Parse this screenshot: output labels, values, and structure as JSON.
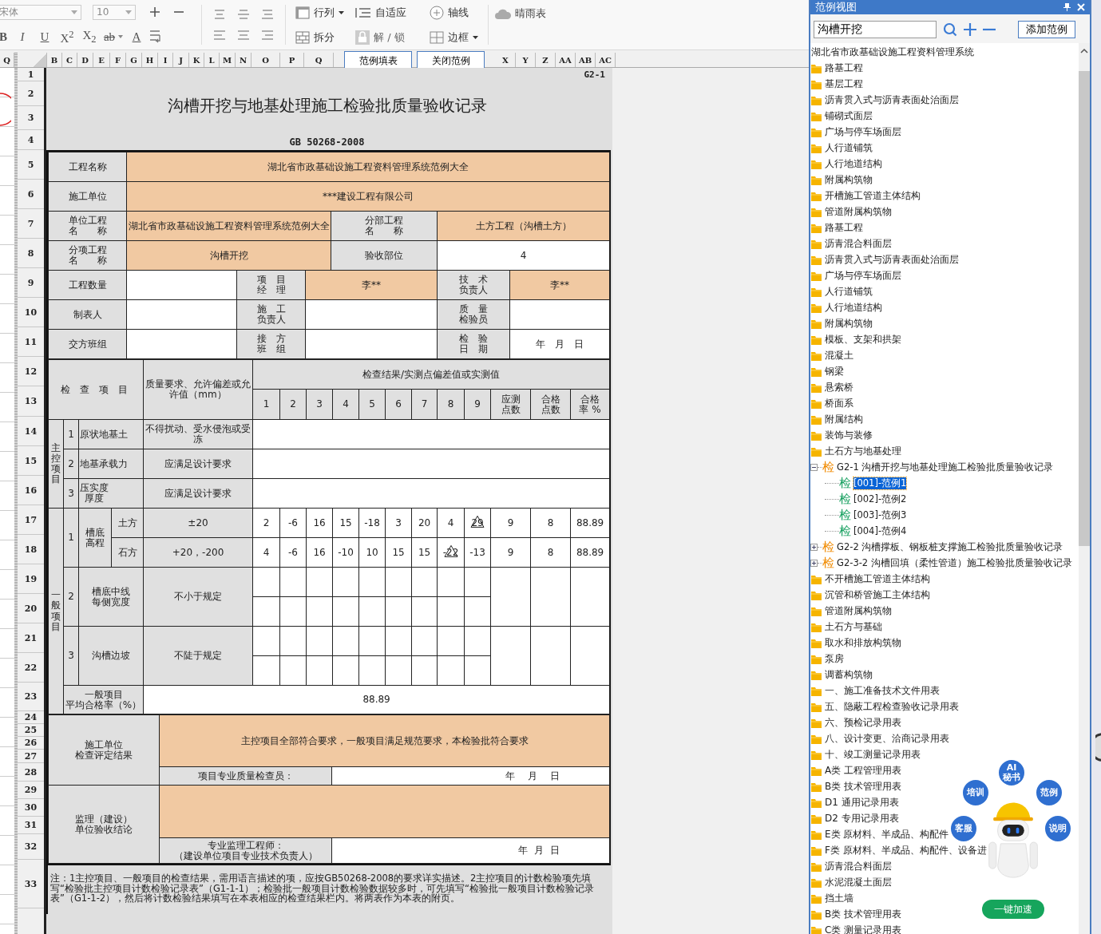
{
  "toolbar": {
    "font": "宋体",
    "size": "10",
    "format_buttons": [
      "B",
      "I",
      "U",
      "X$^{2}$",
      "X$_{2}$",
      "ab",
      "A"
    ],
    "tools": [
      {
        "label": "行列",
        "dropdown": true,
        "disabled": false
      },
      {
        "label": "自适应",
        "dropdown": false,
        "disabled": false
      },
      {
        "label": "轴线",
        "dropdown": false,
        "disabled": false
      },
      {
        "label": "拆分",
        "dropdown": false,
        "disabled": false
      },
      {
        "label": "解 / 锁",
        "dropdown": false,
        "disabled": true
      },
      {
        "label": "边框",
        "dropdown": true,
        "disabled": false
      }
    ],
    "weather": "晴雨表"
  },
  "sheet": {
    "sliver_column": "Q",
    "columns_left": [
      "B",
      "C",
      "D",
      "E",
      "F",
      "G",
      "H",
      "I",
      "J",
      "K",
      "L",
      "M",
      "N",
      "O",
      "P",
      "Q"
    ],
    "sheet_buttons": [
      "范例填表",
      "关闭范例"
    ],
    "columns_right": [
      "X",
      "Y",
      "Z",
      "AA",
      "AB",
      "AC"
    ],
    "rows": [
      "1",
      "2",
      "3",
      "4",
      "5",
      "6",
      "7",
      "8",
      "9",
      "10",
      "11",
      "12",
      "13",
      "14",
      "15",
      "16",
      "17",
      "18",
      "19",
      "20",
      "21",
      "22",
      "23",
      "24",
      "25",
      "26",
      "27",
      "28",
      "29",
      "30",
      "31",
      "32",
      "33"
    ]
  },
  "form": {
    "code": "G2-1",
    "title": "沟槽开挖与地基处理施工检验批质量验收记录",
    "standard": "GB 50268-2008",
    "info_rows": [
      {
        "cells": [
          {
            "text": "工程名称",
            "kind": "label"
          },
          {
            "text": "湖北省市政基础设施工程资料管理系统范例大全",
            "kind": "filled"
          }
        ]
      },
      {
        "cells": [
          {
            "text": "施工单位",
            "kind": "label"
          },
          {
            "text": "***建设工程有限公司",
            "kind": "filled"
          }
        ]
      },
      {
        "cells": [
          {
            "text": "单位工程名称",
            "kind": "label"
          },
          {
            "text": "湖北省市政基础设施工程资料管理系统范例大全",
            "kind": "filled"
          },
          {
            "text": "分部工程名称",
            "kind": "label"
          },
          {
            "text": "土方工程（沟槽土方）",
            "kind": "filled"
          }
        ]
      },
      {
        "cells": [
          {
            "text": "分项工程名称",
            "kind": "label"
          },
          {
            "text": "沟槽开挖",
            "kind": "filled"
          },
          {
            "text": "验收部位",
            "kind": "label"
          },
          {
            "text": "4",
            "kind": "plain"
          }
        ]
      },
      {
        "cells": [
          {
            "text": "工程数量",
            "kind": "label"
          },
          {
            "kind": "plain"
          },
          {
            "text": "项目经理",
            "kind": "label"
          },
          {
            "text": "李**",
            "kind": "filled"
          },
          {
            "text": "技术负责人",
            "kind": "label"
          },
          {
            "text": "李**",
            "kind": "filled"
          }
        ]
      },
      {
        "cells": [
          {
            "text": "制表人",
            "kind": "label"
          },
          {
            "kind": "plain"
          },
          {
            "text": "施工负责人",
            "kind": "label"
          },
          {
            "kind": "plain"
          },
          {
            "text": "质量检验员",
            "kind": "label"
          },
          {
            "kind": "plain"
          }
        ]
      },
      {
        "cells": [
          {
            "text": "交方班组",
            "kind": "label"
          },
          {
            "kind": "plain"
          },
          {
            "text": "接方班组",
            "kind": "label"
          },
          {
            "kind": "plain"
          },
          {
            "text": "检验日期",
            "kind": "label"
          },
          {
            "text": "年　月　日",
            "kind": "plain"
          }
        ]
      }
    ],
    "inspection": {
      "header_item": "检 查 项 目",
      "header_requirement": "质量要求、允许偏差或允许值（mm）",
      "header_results": "检查结果/实测点偏差值或实测值",
      "point_labels": [
        "1",
        "2",
        "3",
        "4",
        "5",
        "6",
        "7",
        "8",
        "9"
      ],
      "summary_labels": [
        "应测点数",
        "合格点数",
        "合格率 %"
      ],
      "main_group": {
        "label": "主控项目",
        "items": [
          {
            "no": "1",
            "name": "原状地基土",
            "requirement": "不得扰动、受水侵泡或受冻"
          },
          {
            "no": "2",
            "name": "地基承载力",
            "requirement": "应满足设计要求"
          },
          {
            "no": "3",
            "name": "压实度厚度",
            "requirement": "应满足设计要求"
          }
        ]
      },
      "general_group": {
        "label": "一般项目",
        "measured": {
          "no": "1",
          "name": "槽底高程",
          "subitems": [
            {
              "name": "土方",
              "requirement": "±20",
              "points": [
                {
                  "value": "2",
                  "flagged": false
                },
                {
                  "value": "-6",
                  "flagged": false
                },
                {
                  "value": "16",
                  "flagged": false
                },
                {
                  "value": "15",
                  "flagged": false
                },
                {
                  "value": "-18",
                  "flagged": false
                },
                {
                  "value": "3",
                  "flagged": false
                },
                {
                  "value": "20",
                  "flagged": false
                },
                {
                  "value": "4",
                  "flagged": false
                },
                {
                  "value": "29",
                  "flagged": true
                }
              ],
              "required": "9",
              "passed": "8",
              "rate": "88.89"
            },
            {
              "name": "石方",
              "requirement": "+20，-200",
              "points": [
                {
                  "value": "4",
                  "flagged": false
                },
                {
                  "value": "-6",
                  "flagged": false
                },
                {
                  "value": "16",
                  "flagged": false
                },
                {
                  "value": "-10",
                  "flagged": false
                },
                {
                  "value": "10",
                  "flagged": false
                },
                {
                  "value": "15",
                  "flagged": false
                },
                {
                  "value": "15",
                  "flagged": false
                },
                {
                  "value": "-22",
                  "flagged": true
                },
                {
                  "value": "-13",
                  "flagged": false
                }
              ],
              "required": "9",
              "passed": "8",
              "rate": "88.89"
            }
          ]
        },
        "items": [
          {
            "no": "2",
            "name": "槽底中线每侧宽度",
            "requirement": "不小于规定"
          },
          {
            "no": "3",
            "name": "沟槽边坡",
            "requirement": "不陡于规定"
          }
        ],
        "average_label": "一般项目平均合格率（%）",
        "average": "88.89"
      }
    },
    "contractor": {
      "label": "施工单位检查评定结果",
      "conclusion": "主控项目全部符合要求，一般项目满足规范要求，本检验批符合要求",
      "signer": "项目专业质量检查员：",
      "date": "年　月　日"
    },
    "supervisor": {
      "label": "监理（建设）单位验收结论",
      "signer": "专业监理工程师：（建设单位项目专业技术负责人）",
      "date": "年 月 日"
    },
    "note": "注：1主控项目、一般项目的检查结果，需用语言描述的项，应按GB50268-2008的要求详实描述。2主控项目的计数检验项先填写“检验批主控项目计数检验记录表”（G1-1-1）；检验批一般项目计数检验数据较多时，可先填写“检验批一般项目计数检验记录表”（G1-1-2），然后将计数检验结果填写在本表相应的检查结果栏内。将两表作为本表的附页。"
  },
  "panel": {
    "title": "范例视图",
    "search": "沟槽开挖",
    "add_button": "添加范例",
    "tree": {
      "label": "湖北省市政基础设施工程资料管理系统",
      "children": [
        {
          "label": "路基工程",
          "kind": "folder"
        },
        {
          "label": "基层工程",
          "kind": "folder"
        },
        {
          "label": "沥青贯入式与沥青表面处治面层",
          "kind": "folder"
        },
        {
          "label": "铺砌式面层",
          "kind": "folder"
        },
        {
          "label": "广场与停车场面层",
          "kind": "folder"
        },
        {
          "label": "人行道铺筑",
          "kind": "folder"
        },
        {
          "label": "人行地道结构",
          "kind": "folder"
        },
        {
          "label": "附属构筑物",
          "kind": "folder"
        },
        {
          "label": "开槽施工管道主体结构",
          "kind": "folder"
        },
        {
          "label": "管道附属构筑物",
          "kind": "folder"
        },
        {
          "label": "路基工程",
          "kind": "folder"
        },
        {
          "label": "沥青混合料面层",
          "kind": "folder"
        },
        {
          "label": "沥青贯入式与沥青表面处治面层",
          "kind": "folder"
        },
        {
          "label": "广场与停车场面层",
          "kind": "folder"
        },
        {
          "label": "人行道铺筑",
          "kind": "folder"
        },
        {
          "label": "人行地道结构",
          "kind": "folder"
        },
        {
          "label": "附属构筑物",
          "kind": "folder"
        },
        {
          "label": "模板、支架和拱架",
          "kind": "folder"
        },
        {
          "label": "混凝土",
          "kind": "folder"
        },
        {
          "label": "钢梁",
          "kind": "folder"
        },
        {
          "label": "悬索桥",
          "kind": "folder"
        },
        {
          "label": "桥面系",
          "kind": "folder"
        },
        {
          "label": "附属结构",
          "kind": "folder"
        },
        {
          "label": "装饰与装修",
          "kind": "folder"
        },
        {
          "label": "土石方与地基处理",
          "kind": "folder"
        },
        {
          "label": "G2-1  沟槽开挖与地基处理施工检验批质量验收记录",
          "kind": "form",
          "badge": "检",
          "expanded": true,
          "children": [
            {
              "label": "[001]-范例1",
              "kind": "example",
              "badge": "检",
              "selected": true
            },
            {
              "label": "[002]-范例2",
              "kind": "example",
              "badge": "检",
              "selected": false
            },
            {
              "label": "[003]-范例3",
              "kind": "example",
              "badge": "检",
              "selected": false
            },
            {
              "label": "[004]-范例4",
              "kind": "example",
              "badge": "检",
              "selected": false
            }
          ]
        },
        {
          "label": "G2-2  沟槽撑板、钢板桩支撑施工检验批质量验收记录",
          "kind": "form",
          "badge": "检",
          "expanded": false
        },
        {
          "label": "G2-3-2  沟槽回填（柔性管道）施工检验批质量验收记录",
          "kind": "form",
          "badge": "检",
          "expanded": false
        },
        {
          "label": "不开槽施工管道主体结构",
          "kind": "folder"
        },
        {
          "label": "沉管和桥管施工主体结构",
          "kind": "folder"
        },
        {
          "label": "管道附属构筑物",
          "kind": "folder"
        },
        {
          "label": "土石方与基础",
          "kind": "folder"
        },
        {
          "label": "取水和排放构筑物",
          "kind": "folder"
        },
        {
          "label": "泵房",
          "kind": "folder"
        },
        {
          "label": "调蓄构筑物",
          "kind": "folder"
        },
        {
          "label": "一、施工准备技术文件用表",
          "kind": "folder"
        },
        {
          "label": "五、隐蔽工程检查验收记录用表",
          "kind": "folder"
        },
        {
          "label": "六、预检记录用表",
          "kind": "folder"
        },
        {
          "label": "八、设计变更、洽商记录用表",
          "kind": "folder"
        },
        {
          "label": "十、竣工测量记录用表",
          "kind": "folder"
        },
        {
          "label": "A类  工程管理用表",
          "kind": "folder"
        },
        {
          "label": "B类  技术管理用表",
          "kind": "folder"
        },
        {
          "label": "D1  通用记录用表",
          "kind": "folder"
        },
        {
          "label": "D2  专用记录用表",
          "kind": "folder"
        },
        {
          "label": "E类  原材料、半成品、构配件",
          "kind": "folder"
        },
        {
          "label": "F类  原材料、半成品、构配件、设备进",
          "kind": "folder"
        },
        {
          "label": "沥青混合料面层",
          "kind": "folder"
        },
        {
          "label": "水泥混凝土面层",
          "kind": "folder"
        },
        {
          "label": "挡土墙",
          "kind": "folder"
        },
        {
          "label": "B类  技术管理用表",
          "kind": "folder"
        },
        {
          "label": "C类  测量记录用表",
          "kind": "folder"
        }
      ]
    }
  },
  "assistant": {
    "bubbles": [
      "AI秘书",
      "培训",
      "范例",
      "客服",
      "说明"
    ],
    "boost": "一键加速"
  }
}
